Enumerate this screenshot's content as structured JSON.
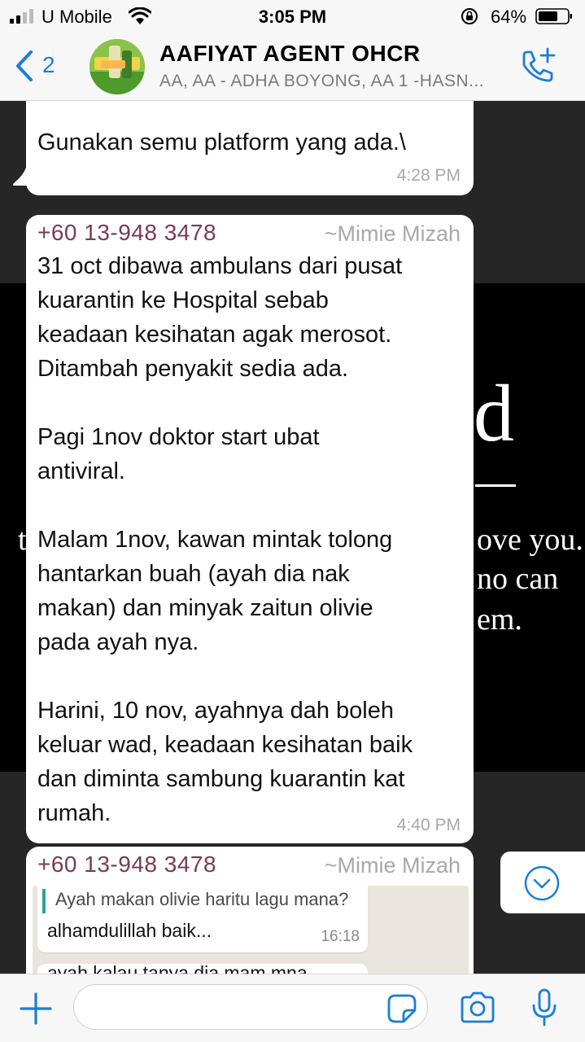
{
  "status_bar": {
    "carrier": "U Mobile",
    "time": "3:05 PM",
    "battery_percent": "64%"
  },
  "header": {
    "back_count": "2",
    "group_name": "AAFIYAT AGENT OHCR",
    "members": "AA, AA - ADHA BOYONG, AA 1 -HASN..."
  },
  "wallpaper": {
    "big_letter": "d",
    "lines": [
      "t",
      "ove you.",
      "no can",
      "em."
    ]
  },
  "messages": [
    {
      "text": "Gunakan semu platform yang ada.\\",
      "time": "4:28 PM"
    },
    {
      "sender_phone": "+60 13-948 3478",
      "sender_name": "~Mimie Mizah",
      "text": "31 oct dibawa ambulans dari pusat\nkuarantin ke Hospital sebab\nkeadaan kesihatan agak merosot.\nDitambah penyakit sedia ada.\n\nPagi 1nov doktor start ubat\nantiviral.\n\nMalam 1nov, kawan mintak tolong\nhantarkan buah (ayah dia nak\nmakan) dan minyak zaitun olivie\npada ayah nya.\n\nHarini, 10 nov, ayahnya dah boleh\nkeluar wad, keadaan kesihatan baik\ndan diminta sambung kuarantin kat\nrumah.",
      "time": "4:40 PM"
    },
    {
      "sender_phone": "+60 13-948 3478",
      "sender_name": "~Mimie Mizah",
      "image": {
        "quoted": "Ayah makan olivie haritu lagu mana?",
        "reply": "alhamdulillah baik...",
        "reply_time": "16:18",
        "next_line": "ayah kalau tanya dia mam mna"
      }
    }
  ],
  "input": {
    "placeholder": ""
  },
  "colors": {
    "accent": "#1a7ed8",
    "sender": "#7a3a54",
    "bubble": "#ffffff",
    "bar": "#f7f7f7"
  }
}
